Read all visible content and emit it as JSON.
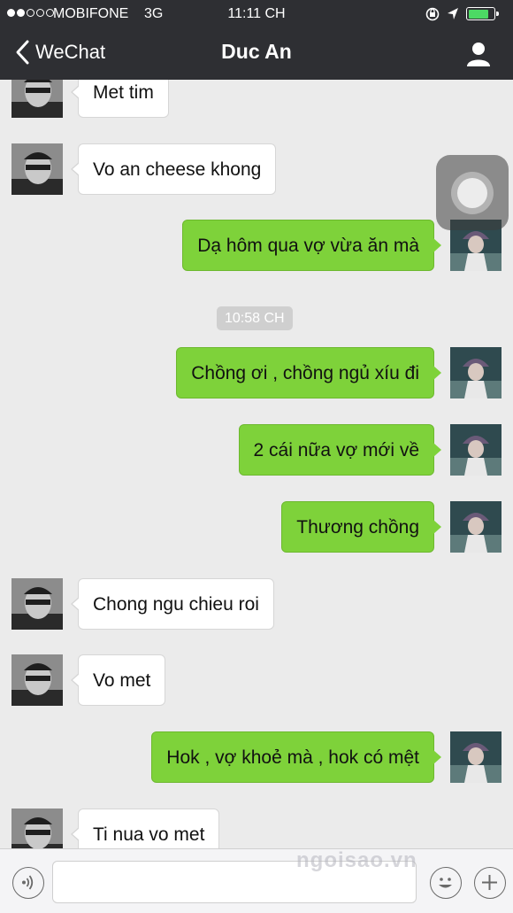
{
  "status_bar": {
    "carrier": "MOBIFONE",
    "network": "3G",
    "time": "11:11 CH",
    "battery_level": 0.8,
    "battery_color": "#4cd964"
  },
  "nav": {
    "back_label": "WeChat",
    "title": "Duc An",
    "back_icon": "chevron-left-icon",
    "profile_icon": "person-icon"
  },
  "messages": [
    {
      "from": "contact",
      "text": "Met tim"
    },
    {
      "from": "contact",
      "text": "Vo an cheese khong"
    },
    {
      "from": "me",
      "text": "Dạ hôm qua vợ vừa ăn mà"
    },
    {
      "from": "system",
      "text": "10:58 CH"
    },
    {
      "from": "me",
      "text": "Chồng ơi , chồng ngủ xíu đi"
    },
    {
      "from": "me",
      "text": "2 cái nữa vợ mới về"
    },
    {
      "from": "me",
      "text": "Thương chồng"
    },
    {
      "from": "contact",
      "text": "Chong ngu chieu roi"
    },
    {
      "from": "contact",
      "text": "Vo met"
    },
    {
      "from": "me",
      "text": "Hok , vợ khoẻ mà , hok có mệt"
    },
    {
      "from": "contact",
      "text": "Ti nua vo met"
    }
  ],
  "input_bar": {
    "voice_icon": "voice-icon",
    "emoji_icon": "emoji-icon",
    "plus_icon": "plus-icon",
    "text_value": ""
  },
  "colors": {
    "outgoing_bubble": "#7ed23a",
    "incoming_bubble": "#ffffff",
    "header_bg": "#2e2f33",
    "chat_bg": "#ebebeb"
  },
  "watermark": "ngoisao.vn"
}
